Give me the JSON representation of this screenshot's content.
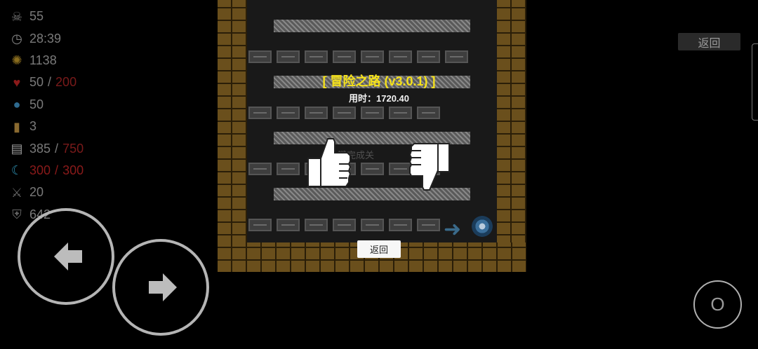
{
  "stats": [
    {
      "icon": "skull-icon",
      "value": "55"
    },
    {
      "icon": "clock-icon",
      "value": "28:39"
    },
    {
      "icon": "gold-coin-icon",
      "value": "1138"
    },
    {
      "icon": "heart-icon",
      "value": "50",
      "max": "200"
    },
    {
      "icon": "globe-icon",
      "value": "50"
    },
    {
      "icon": "book-icon",
      "value": "3"
    },
    {
      "icon": "scroll-icon",
      "value": "385",
      "max": "750"
    },
    {
      "icon": "crescent-icon",
      "value": "300",
      "max": "300"
    },
    {
      "icon": "sword-icon",
      "value": "20"
    },
    {
      "icon": "shield-icon",
      "value": "642"
    }
  ],
  "separator": "/",
  "top_right": {
    "back_label": "返回"
  },
  "game": {
    "title": "[ 冒险之路 (v3.0.1) ]",
    "elapsed_time": "用时：1720.40",
    "back_label": "返回",
    "dim_hint": "[O] 键完成关"
  },
  "controls": {
    "o_label": "O"
  },
  "colors": {
    "title": "#f6e21a",
    "max_red": "#7a1a1a",
    "brick": "#6a4f1c"
  }
}
